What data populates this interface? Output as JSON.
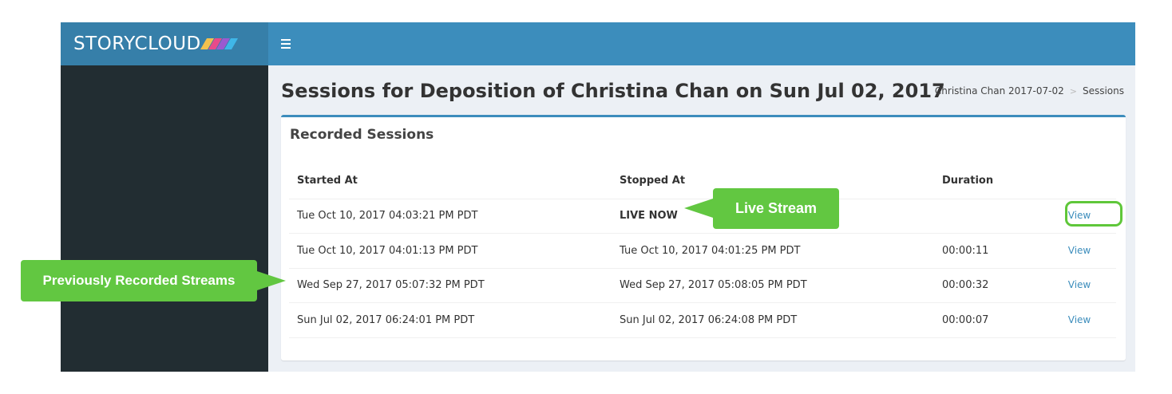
{
  "app": {
    "logo_text": "STORYCLOUD",
    "logo_colors": [
      "#f2c14e",
      "#e84a8a",
      "#9b59d0",
      "#3fb6e8"
    ],
    "header_color": "#3c8dbc",
    "sidebar_color": "#222d32"
  },
  "header": {
    "menu_icon": "hamburger-icon"
  },
  "page": {
    "title": "Sessions for Deposition of Christina Chan on Sun Jul 02, 2017",
    "breadcrumb": {
      "items": [
        "Christina Chan 2017-07-02",
        "Sessions"
      ],
      "separator": ">"
    }
  },
  "box": {
    "title": "Recorded Sessions"
  },
  "table": {
    "columns": [
      "Started At",
      "Stopped At",
      "Duration",
      ""
    ],
    "rows": [
      {
        "started": "Tue Oct 10, 2017 04:03:21 PM PDT",
        "stopped": "LIVE NOW",
        "duration": "",
        "action": "View"
      },
      {
        "started": "Tue Oct 10, 2017 04:01:13 PM PDT",
        "stopped": "Tue Oct 10, 2017 04:01:25 PM PDT",
        "duration": "00:00:11",
        "action": "View"
      },
      {
        "started": "Wed Sep 27, 2017 05:07:32 PM PDT",
        "stopped": "Wed Sep 27, 2017 05:08:05 PM PDT",
        "duration": "00:00:32",
        "action": "View"
      },
      {
        "started": "Sun Jul 02, 2017 06:24:01 PM PDT",
        "stopped": "Sun Jul 02, 2017 06:24:08 PM PDT",
        "duration": "00:00:07",
        "action": "View"
      }
    ]
  },
  "annotations": {
    "live_stream": "Live Stream",
    "previously_recorded": "Previously Recorded Streams",
    "callout_color": "#62c741"
  }
}
